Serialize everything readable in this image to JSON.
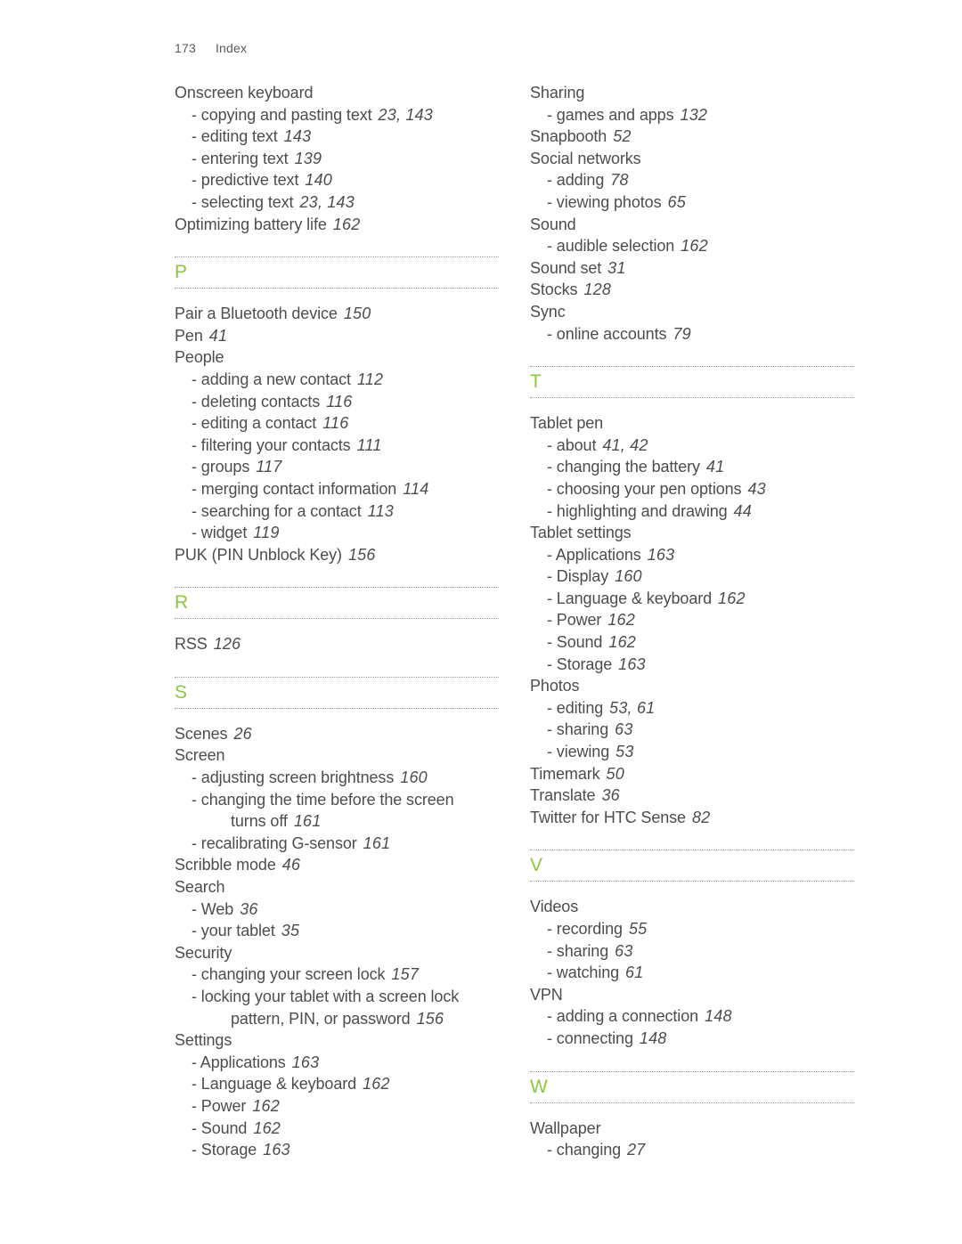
{
  "header": {
    "page_number": "173",
    "title": "Index"
  },
  "colors": {
    "letter_green": "#8cc63e",
    "text_gray": "#4d4d4d",
    "rule_gray": "#9b9b9b"
  },
  "columns": [
    {
      "name": "left-column",
      "blocks": [
        {
          "type": "entries",
          "entries": [
            {
              "level": "main",
              "text": "Onscreen keyboard",
              "page": ""
            },
            {
              "level": "sub",
              "text": "- copying and pasting text",
              "page": "23, 143"
            },
            {
              "level": "sub",
              "text": "- editing text",
              "page": "143"
            },
            {
              "level": "sub",
              "text": "- entering text",
              "page": "139"
            },
            {
              "level": "sub",
              "text": "- predictive text",
              "page": "140"
            },
            {
              "level": "sub",
              "text": "- selecting text",
              "page": "23, 143"
            },
            {
              "level": "main",
              "text": "Optimizing battery life",
              "page": "162"
            }
          ]
        },
        {
          "type": "letter",
          "letter": "P"
        },
        {
          "type": "entries",
          "entries": [
            {
              "level": "main",
              "text": "Pair a Bluetooth device",
              "page": "150"
            },
            {
              "level": "main",
              "text": "Pen",
              "page": "41"
            },
            {
              "level": "main",
              "text": "People",
              "page": ""
            },
            {
              "level": "sub",
              "text": "- adding a new contact",
              "page": "112"
            },
            {
              "level": "sub",
              "text": "- deleting contacts",
              "page": "116"
            },
            {
              "level": "sub",
              "text": "- editing a contact",
              "page": "116"
            },
            {
              "level": "sub",
              "text": "- filtering your contacts",
              "page": "111"
            },
            {
              "level": "sub",
              "text": "- groups",
              "page": "117"
            },
            {
              "level": "sub",
              "text": "- merging contact information",
              "page": "114"
            },
            {
              "level": "sub",
              "text": "- searching for a contact",
              "page": "113"
            },
            {
              "level": "sub",
              "text": "- widget",
              "page": "119"
            },
            {
              "level": "main",
              "text": "PUK (PIN Unblock Key)",
              "page": "156"
            }
          ]
        },
        {
          "type": "letter",
          "letter": "R"
        },
        {
          "type": "entries",
          "entries": [
            {
              "level": "main",
              "text": "RSS",
              "page": "126"
            }
          ]
        },
        {
          "type": "letter",
          "letter": "S"
        },
        {
          "type": "entries",
          "entries": [
            {
              "level": "main",
              "text": "Scenes",
              "page": "26"
            },
            {
              "level": "main",
              "text": "Screen",
              "page": ""
            },
            {
              "level": "sub",
              "text": "- adjusting screen brightness",
              "page": "160"
            },
            {
              "level": "wrap",
              "text": "- changing the time before the screen",
              "continuation": "turns off",
              "page": "161"
            },
            {
              "level": "sub",
              "text": "- recalibrating G-sensor",
              "page": "161"
            },
            {
              "level": "main",
              "text": "Scribble mode",
              "page": "46"
            },
            {
              "level": "main",
              "text": "Search",
              "page": ""
            },
            {
              "level": "sub",
              "text": "- Web",
              "page": "36"
            },
            {
              "level": "sub",
              "text": "- your tablet",
              "page": "35"
            },
            {
              "level": "main",
              "text": "Security",
              "page": ""
            },
            {
              "level": "sub",
              "text": "- changing your screen lock",
              "page": "157"
            },
            {
              "level": "wrap",
              "text": "- locking your tablet with a screen lock",
              "continuation": "pattern, PIN, or password",
              "page": "156"
            },
            {
              "level": "main",
              "text": "Settings",
              "page": ""
            },
            {
              "level": "sub",
              "text": "- Applications",
              "page": "163"
            },
            {
              "level": "sub",
              "text": "- Language & keyboard",
              "page": "162"
            },
            {
              "level": "sub",
              "text": "- Power",
              "page": "162"
            },
            {
              "level": "sub",
              "text": "- Sound",
              "page": "162"
            },
            {
              "level": "sub",
              "text": "- Storage",
              "page": "163"
            }
          ]
        }
      ]
    },
    {
      "name": "right-column",
      "blocks": [
        {
          "type": "entries",
          "entries": [
            {
              "level": "main",
              "text": "Sharing",
              "page": ""
            },
            {
              "level": "sub",
              "text": "- games and apps",
              "page": "132"
            },
            {
              "level": "main",
              "text": "Snapbooth",
              "page": "52"
            },
            {
              "level": "main",
              "text": "Social networks",
              "page": ""
            },
            {
              "level": "sub",
              "text": "- adding",
              "page": "78"
            },
            {
              "level": "sub",
              "text": "- viewing photos",
              "page": "65"
            },
            {
              "level": "main",
              "text": "Sound",
              "page": ""
            },
            {
              "level": "sub",
              "text": "- audible selection",
              "page": "162"
            },
            {
              "level": "main",
              "text": "Sound set",
              "page": "31"
            },
            {
              "level": "main",
              "text": "Stocks",
              "page": "128"
            },
            {
              "level": "main",
              "text": "Sync",
              "page": ""
            },
            {
              "level": "sub",
              "text": "- online accounts",
              "page": "79"
            }
          ]
        },
        {
          "type": "letter",
          "letter": "T"
        },
        {
          "type": "entries",
          "entries": [
            {
              "level": "main",
              "text": "Tablet pen",
              "page": ""
            },
            {
              "level": "sub",
              "text": "- about",
              "page": "41, 42"
            },
            {
              "level": "sub",
              "text": "- changing the battery",
              "page": "41"
            },
            {
              "level": "sub",
              "text": "- choosing your pen options",
              "page": "43"
            },
            {
              "level": "sub",
              "text": "- highlighting and drawing",
              "page": "44"
            },
            {
              "level": "main",
              "text": "Tablet settings",
              "page": ""
            },
            {
              "level": "sub",
              "text": "- Applications",
              "page": "163"
            },
            {
              "level": "sub",
              "text": "- Display",
              "page": "160"
            },
            {
              "level": "sub",
              "text": "- Language & keyboard",
              "page": "162"
            },
            {
              "level": "sub",
              "text": "- Power",
              "page": "162"
            },
            {
              "level": "sub",
              "text": "- Sound",
              "page": "162"
            },
            {
              "level": "sub",
              "text": "- Storage",
              "page": "163"
            },
            {
              "level": "main",
              "text": "Photos",
              "page": ""
            },
            {
              "level": "sub",
              "text": "- editing",
              "page": "53, 61"
            },
            {
              "level": "sub",
              "text": "- sharing",
              "page": "63"
            },
            {
              "level": "sub",
              "text": "- viewing",
              "page": "53"
            },
            {
              "level": "main",
              "text": "Timemark",
              "page": "50"
            },
            {
              "level": "main",
              "text": "Translate",
              "page": "36"
            },
            {
              "level": "main",
              "text": "Twitter for HTC Sense",
              "page": "82"
            }
          ]
        },
        {
          "type": "letter",
          "letter": "V"
        },
        {
          "type": "entries",
          "entries": [
            {
              "level": "main",
              "text": "Videos",
              "page": ""
            },
            {
              "level": "sub",
              "text": "- recording",
              "page": "55"
            },
            {
              "level": "sub",
              "text": "- sharing",
              "page": "63"
            },
            {
              "level": "sub",
              "text": "- watching",
              "page": "61"
            },
            {
              "level": "main",
              "text": "VPN",
              "page": ""
            },
            {
              "level": "sub",
              "text": "- adding a connection",
              "page": "148"
            },
            {
              "level": "sub",
              "text": "- connecting",
              "page": "148"
            }
          ]
        },
        {
          "type": "letter",
          "letter": "W"
        },
        {
          "type": "entries",
          "entries": [
            {
              "level": "main",
              "text": "Wallpaper",
              "page": ""
            },
            {
              "level": "sub",
              "text": "- changing",
              "page": "27"
            }
          ]
        }
      ]
    }
  ]
}
